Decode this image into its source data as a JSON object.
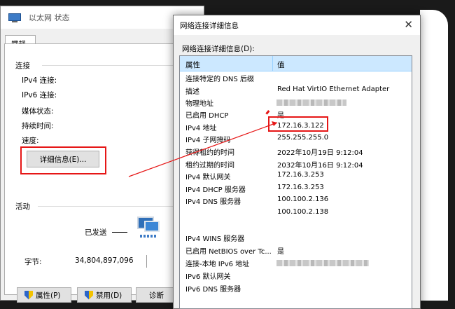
{
  "status_window": {
    "title": "以太网 状态",
    "tab_general": "常规",
    "section_connection": "连接",
    "fields": {
      "ipv4_connectivity": "IPv4 连接:",
      "ipv6_connectivity": "IPv6 连接:",
      "media_state": "媒体状态:",
      "duration": "持续时间:",
      "speed": "速度:"
    },
    "details_button": "详细信息(E)...",
    "section_activity": "活动",
    "sent_label": "已发送",
    "bytes_label": "字节:",
    "bytes_sent": "34,804,897,096",
    "buttons": {
      "properties": "属性(P)",
      "disable": "禁用(D)",
      "diagnose": "诊断"
    }
  },
  "details_dialog": {
    "title": "网络连接详细信息",
    "list_label": "网络连接详细信息(D):",
    "col_property": "属性",
    "col_value": "值",
    "rows": [
      {
        "key": "连接特定的 DNS 后缀",
        "value": ""
      },
      {
        "key": "描述",
        "value": "Red Hat VirtIO Ethernet Adapter"
      },
      {
        "key": "物理地址",
        "value": ""
      },
      {
        "key": "已启用 DHCP",
        "value": "是"
      },
      {
        "key": "IPv4 地址",
        "value": "172.16.3.122"
      },
      {
        "key": "IPv4 子网掩码",
        "value": "255.255.255.0"
      },
      {
        "key": "获得租约的时间",
        "value": "2022年10月19日 9:12:04"
      },
      {
        "key": "租约过期的时间",
        "value": "2032年10月16日 9:12:04"
      },
      {
        "key": "IPv4 默认网关",
        "value": "172.16.3.253"
      },
      {
        "key": "IPv4 DHCP 服务器",
        "value": "172.16.3.253"
      },
      {
        "key": "IPv4 DNS 服务器",
        "value": "100.100.2.136"
      },
      {
        "key": "",
        "value": "100.100.2.138"
      },
      {
        "key": "IPv4 WINS 服务器",
        "value": ""
      },
      {
        "key": "已启用 NetBIOS over Tc...",
        "value": "是"
      },
      {
        "key": "连接-本地 IPv6 地址",
        "value": ""
      },
      {
        "key": "IPv6 默认网关",
        "value": ""
      },
      {
        "key": "IPv6 DNS 服务器",
        "value": ""
      }
    ]
  },
  "colors": {
    "highlight_red": "#e61616",
    "header_blue": "#cce8ff"
  }
}
